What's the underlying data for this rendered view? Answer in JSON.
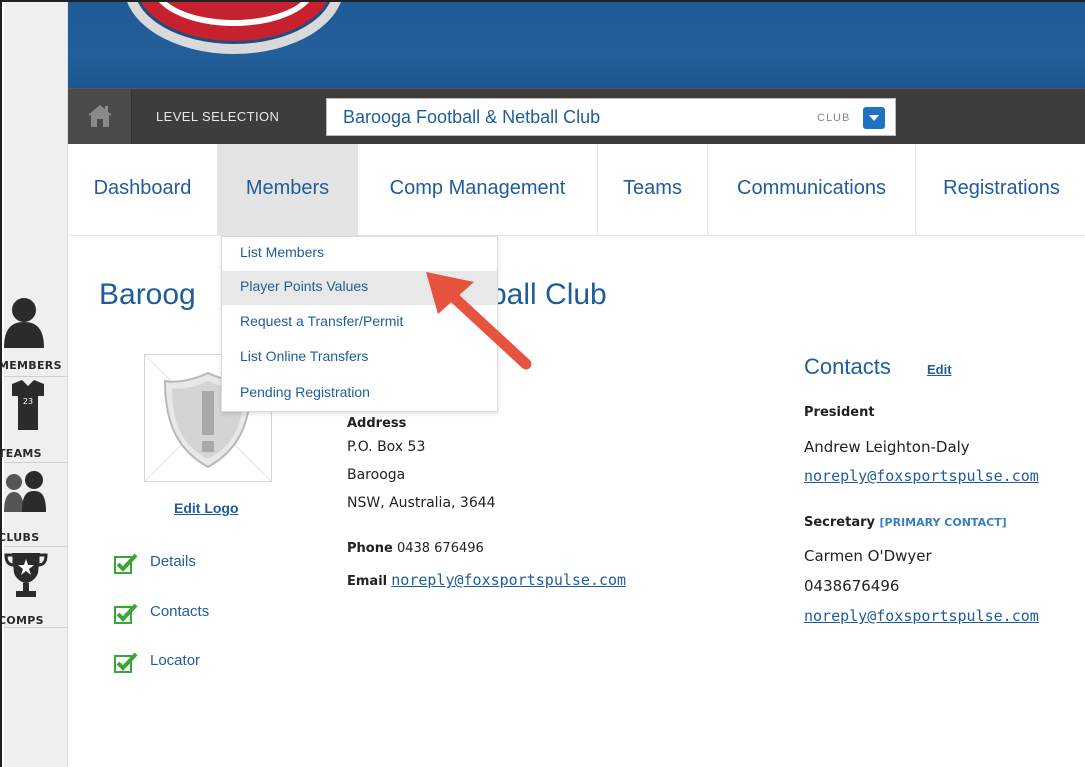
{
  "rail": {
    "items": [
      {
        "label": "MEMBERS",
        "icon": "person-icon"
      },
      {
        "label": "TEAMS",
        "icon": "jersey-icon",
        "jersey_number": "23"
      },
      {
        "label": "CLUBS",
        "icon": "group-icon"
      },
      {
        "label": "COMPS",
        "icon": "trophy-icon"
      }
    ]
  },
  "header": {
    "level_selection_label": "LEVEL SELECTION",
    "level_value": "Barooga Football & Netball Club",
    "level_type": "CLUB"
  },
  "nav": {
    "items": [
      {
        "label": "Dashboard"
      },
      {
        "label": "Members"
      },
      {
        "label": "Comp Management"
      },
      {
        "label": "Teams"
      },
      {
        "label": "Communications"
      },
      {
        "label": "Registrations"
      }
    ],
    "active": "Members"
  },
  "members_menu": {
    "items": [
      {
        "label": "List Members"
      },
      {
        "label": "Player Points Values"
      },
      {
        "label": "Request a Transfer/Permit"
      },
      {
        "label": "List Online Transfers"
      },
      {
        "label": "Pending Registration"
      }
    ],
    "highlighted": "Player Points Values"
  },
  "page": {
    "title_start": "Baroog",
    "title_end": "ball Club",
    "edit_logo": "Edit Logo",
    "checklist": [
      {
        "label": "Details",
        "checked": true
      },
      {
        "label": "Contacts",
        "checked": true
      },
      {
        "label": "Locator",
        "checked": true
      }
    ],
    "address_heading": "Address",
    "address_lines": [
      "P.O. Box 53",
      "Barooga",
      "NSW,  Australia,  3644"
    ],
    "phone_label": "Phone",
    "phone_value": "0438 676496",
    "email_label": "Email",
    "email_value": "noreply@foxsportspulse.com"
  },
  "contacts": {
    "title": "Contacts",
    "edit_label": "Edit",
    "president": {
      "role": "President",
      "name": "Andrew Leighton-Daly",
      "email": "noreply@foxsportspulse.com"
    },
    "secretary": {
      "role": "Secretary",
      "role_note": "[PRIMARY CONTACT]",
      "name": "Carmen O'Dwyer",
      "phone": "0438676496",
      "email": "noreply@foxsportspulse.com"
    }
  },
  "colors": {
    "brand_blue": "#1f5d99",
    "banner_blue": "#235f9b",
    "level_bar": "#3d3d3d",
    "annotation_arrow": "#e8533f",
    "check_green": "#3aa635"
  }
}
